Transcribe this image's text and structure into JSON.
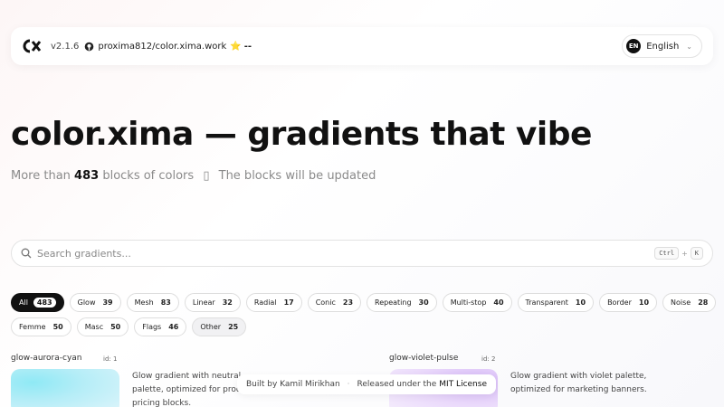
{
  "header": {
    "version": "v2.1.6",
    "repo": "proxima812/color.xima.work",
    "star": "⭐",
    "stars": "--",
    "lang_code": "EN",
    "lang_label": "English"
  },
  "hero": {
    "title": "color.xima — gradients that vibe",
    "sub_prefix": "More than",
    "block_count": "483",
    "sub_middle": "blocks of colors",
    "sub_glyph": "▯",
    "sub_suffix": "The blocks will be updated"
  },
  "search": {
    "placeholder": "Search gradients...",
    "key1": "Ctrl",
    "plus": "+",
    "key2": "K"
  },
  "filters": {
    "row1": [
      {
        "label": "All",
        "count": "483"
      },
      {
        "label": "Glow",
        "count": "39"
      },
      {
        "label": "Mesh",
        "count": "83"
      },
      {
        "label": "Linear",
        "count": "32"
      },
      {
        "label": "Radial",
        "count": "17"
      },
      {
        "label": "Conic",
        "count": "23"
      },
      {
        "label": "Repeating",
        "count": "30"
      },
      {
        "label": "Multi-stop",
        "count": "40"
      },
      {
        "label": "Transparent",
        "count": "10"
      },
      {
        "label": "Border",
        "count": "10"
      },
      {
        "label": "Noise",
        "count": "28"
      }
    ],
    "row2": [
      {
        "label": "Femme",
        "count": "50"
      },
      {
        "label": "Masc",
        "count": "50"
      },
      {
        "label": "Flags",
        "count": "46"
      },
      {
        "label": "Other",
        "count": "25"
      }
    ]
  },
  "cards": [
    {
      "name": "glow-aurora-cyan",
      "id": "id: 1",
      "desc1": "Glow gradient with neutral",
      "desc2": "palette, optimized for product",
      "desc3": "pricing blocks."
    },
    {
      "name": "glow-violet-pulse",
      "id": "id: 2",
      "desc1": "Glow gradient with violet palette,",
      "desc2": "optimized for marketing banners."
    }
  ],
  "footer": {
    "built": "Built by Kamil Mirikhan",
    "dot": "·",
    "released": "Released under the",
    "license": "MIT License"
  },
  "colors": {
    "accent": "#111111",
    "muted": "#8a8a8a"
  }
}
